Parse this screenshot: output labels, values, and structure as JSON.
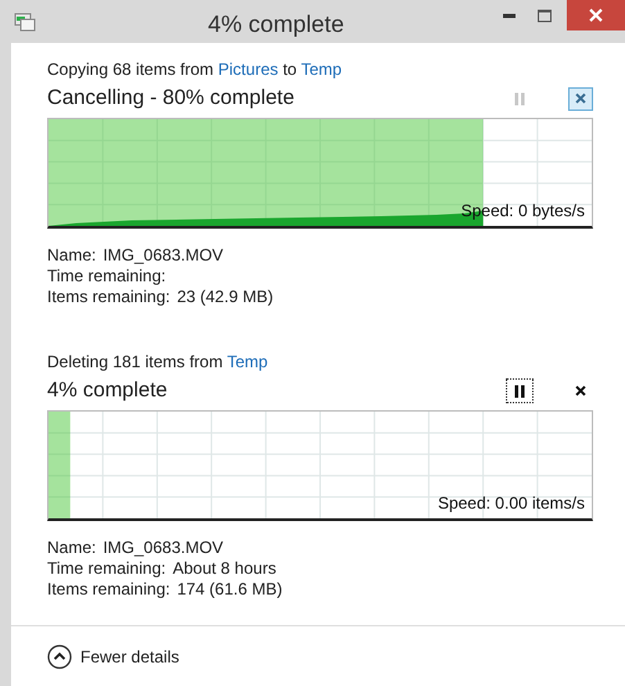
{
  "window": {
    "title": "4% complete"
  },
  "operations": [
    {
      "description": [
        {
          "kind": "text",
          "text": "Copying 68 items from "
        },
        {
          "kind": "link",
          "text": "Pictures"
        },
        {
          "kind": "text",
          "text": " to "
        },
        {
          "kind": "link",
          "text": "Temp"
        }
      ],
      "status": "Cancelling - 80% complete",
      "pause_disabled": true,
      "pause_focused": false,
      "cancel_highlighted": true,
      "level": 0.8,
      "speed": "Speed: 0 bytes/s",
      "speed_graph": true,
      "details": [
        {
          "label": "Name:",
          "value": "IMG_0683.MOV"
        },
        {
          "label": "Time remaining:"
        },
        {
          "label": "Items remaining:",
          "value": "23 (42.9 MB)"
        }
      ]
    },
    {
      "description": [
        {
          "kind": "text",
          "text": "Deleting 181 items from "
        },
        {
          "kind": "link",
          "text": "Temp"
        }
      ],
      "status": "4% complete",
      "pause_disabled": false,
      "pause_focused": true,
      "cancel_highlighted": false,
      "level": 0.04,
      "speed": "Speed: 0.00 items/s",
      "speed_graph": false,
      "details": [
        {
          "label": "Name:",
          "value": "IMG_0683.MOV"
        },
        {
          "label": "Time remaining:",
          "value": "About 8 hours"
        },
        {
          "label": "Items remaining:",
          "value": "174 (61.6 MB)"
        }
      ]
    }
  ],
  "footer": {
    "toggle": "Fewer details"
  }
}
